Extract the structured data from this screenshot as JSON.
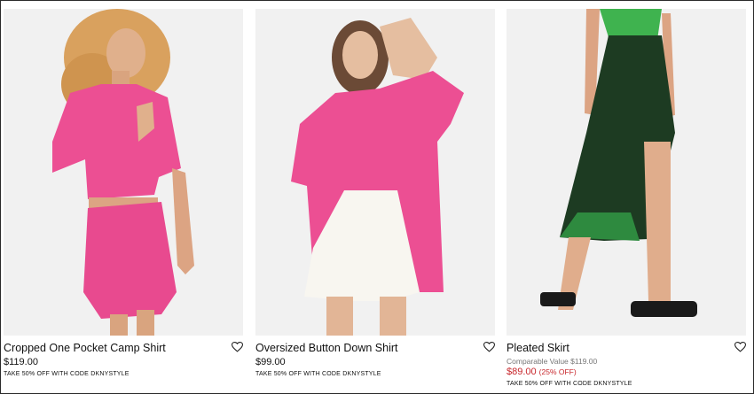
{
  "products": [
    {
      "name": "Cropped One Pocket Camp Shirt",
      "price": "$119.00",
      "promo": "TAKE 50% OFF WITH CODE DKNYSTYLE",
      "wishlist_icon": "heart-outline-icon"
    },
    {
      "name": "Oversized Button Down Shirt",
      "price": "$99.00",
      "promo": "TAKE 50% OFF WITH CODE DKNYSTYLE",
      "wishlist_icon": "heart-outline-icon"
    },
    {
      "name": "Pleated Skirt",
      "compare_value": "Comparable Value $119.00",
      "sale_price": "$89.00",
      "sale_percent": "(25% OFF)",
      "promo": "TAKE 50% OFF WITH CODE DKNYSTYLE",
      "wishlist_icon": "heart-outline-icon"
    }
  ],
  "colors": {
    "sale": "#c7262b",
    "image_bg": "#f1f1f1",
    "pink": "#ec4f93",
    "green_skirt": "#1d3b22"
  }
}
